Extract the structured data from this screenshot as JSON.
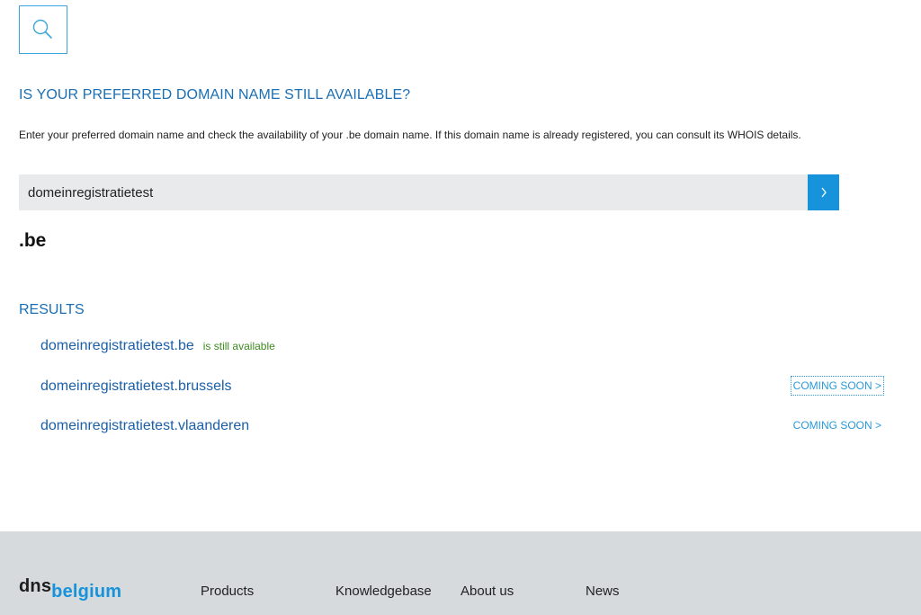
{
  "search": {
    "icon": "search-icon",
    "heading": "IS YOUR PREFERRED DOMAIN NAME STILL AVAILABLE?",
    "intro": "Enter your preferred domain name and check the availability of your .be domain name. If this domain name is already registered, you can consult its WHOIS details.",
    "query_value": "domeinregistratietest",
    "submit_icon": "chevron-right-icon",
    "extension": ".be"
  },
  "results": {
    "title": "RESULTS",
    "items": [
      {
        "domain": "domeinregistratietest.be",
        "status": "is still available",
        "action": ""
      },
      {
        "domain": "domeinregistratietest.brussels",
        "status": "",
        "action": "COMING SOON >"
      },
      {
        "domain": "domeinregistratietest.vlaanderen",
        "status": "",
        "action": "COMING SOON >"
      }
    ]
  },
  "footer": {
    "logo_part1": "dns",
    "logo_part2": "belgium",
    "nav": [
      "Products",
      "Knowledgebase",
      "About us",
      "News"
    ]
  },
  "colors": {
    "accent": "#1793db",
    "heading": "#1a6fb5",
    "available": "#3c8a1e",
    "footer_bg": "#d6dadd"
  }
}
